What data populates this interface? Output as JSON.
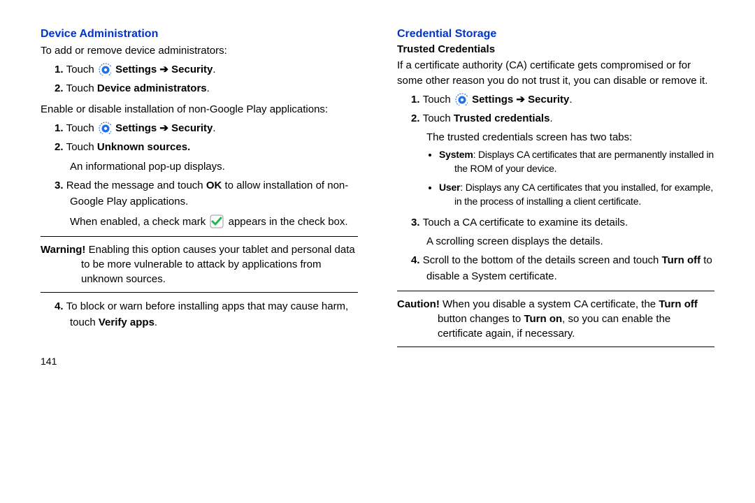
{
  "left": {
    "heading": "Device Administration",
    "intro": "To add or remove device administrators:",
    "step1_a": "Touch ",
    "step1_b": "Settings",
    "step1_c": "Security",
    "step2": "Device administrators",
    "enable_intro": "Enable or disable installation of non-Google Play applications:",
    "b_step1_a": "Touch ",
    "b_step1_b": "Settings",
    "b_step1_c": "Security",
    "b_step2_a": "Touch ",
    "b_step2_b": "Unknown sources.",
    "b_step2_cont": "An informational pop-up displays.",
    "b_step3_a": "Read the message and touch ",
    "b_step3_b": "OK",
    "b_step3_c": " to allow installation of non-Google Play applications.",
    "b_step3_cont_a": "When enabled, a check mark ",
    "b_step3_cont_b": " appears in the check box.",
    "warn_label": "Warning!",
    "warn_body": " Enabling this option causes your tablet and personal data to be more vulnerable to attack by applications from unknown sources.",
    "b_step4_a": "To block or warn before installing apps that may cause harm, touch ",
    "b_step4_b": "Verify apps",
    "page": "141"
  },
  "right": {
    "heading": "Credential Storage",
    "sub": "Trusted Credentials",
    "intro": "If a certificate authority (CA) certificate gets compromised or for some other reason you do not trust it, you can disable or remove it.",
    "step1_a": "Touch ",
    "step1_b": "Settings",
    "step1_c": "Security",
    "step2_a": "Touch ",
    "step2_b": "Trusted credentials",
    "step2_cont": "The trusted credentials screen has two tabs:",
    "bullet_sys_a": "System",
    "bullet_sys_b": ": Displays CA certificates that are permanently installed in the ROM of your device.",
    "bullet_usr_a": "User",
    "bullet_usr_b": ": Displays any CA certificates that you installed, for example, in the process of installing a client certificate.",
    "step3_a": "Touch a CA certificate to examine its details.",
    "step3_cont": "A scrolling screen displays the details.",
    "step4_a": "Scroll to the bottom of the details screen and touch ",
    "step4_b": "Turn off",
    "step4_c": " to disable a System certificate.",
    "caution_label": "Caution!",
    "caution_a": " When you disable a system CA certificate, the ",
    "caution_b": "Turn off",
    "caution_c": " button changes to ",
    "caution_d": "Turn on",
    "caution_e": ", so you can enable the certificate again, if necessary."
  }
}
